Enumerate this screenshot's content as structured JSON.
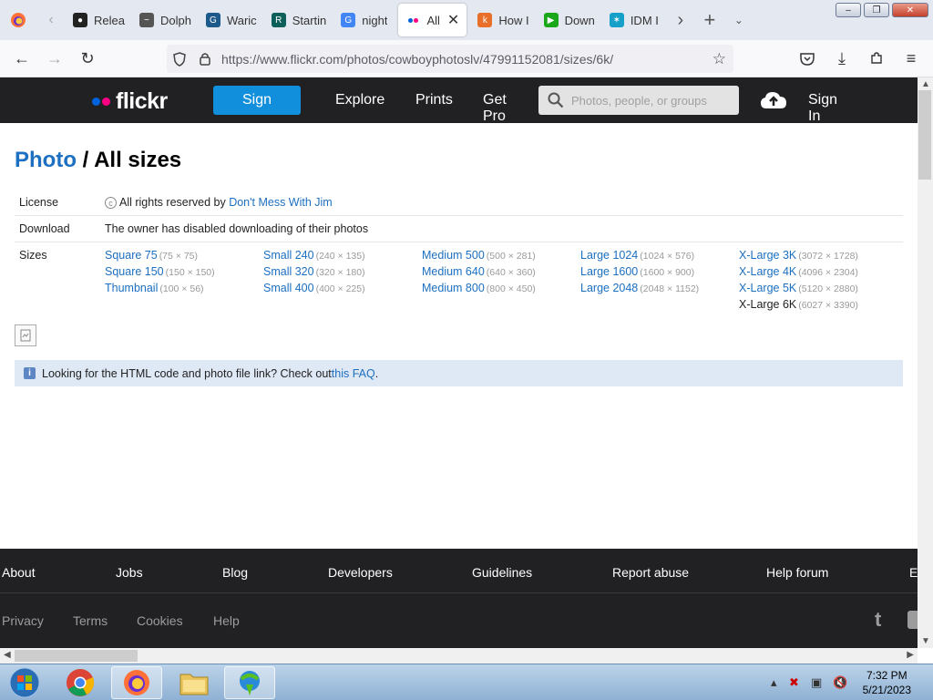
{
  "browser": {
    "tabs": [
      {
        "label": "Relea",
        "icon": "github-icon"
      },
      {
        "label": "Dolph",
        "icon": "dolphin-icon"
      },
      {
        "label": "Waric",
        "icon": "g-logo-icon"
      },
      {
        "label": "Startin",
        "icon": "r-logo-icon"
      },
      {
        "label": "night",
        "icon": "google-icon"
      },
      {
        "label": "All",
        "icon": "flickr-icon",
        "active": true
      },
      {
        "label": "How I",
        "icon": "orange-logo-icon"
      },
      {
        "label": "Down",
        "icon": "play-icon"
      },
      {
        "label": "IDM I",
        "icon": "idm-icon"
      }
    ],
    "url": "https://www.flickr.com/photos/cowboyphotoslv/47991152081/sizes/6k/"
  },
  "header": {
    "logo": "flickr",
    "sign_label": "Sign",
    "explore": "Explore",
    "prints": "Prints",
    "getpro": "Get Pro",
    "search_placeholder": "Photos, people, or groups",
    "signin": "Sign In",
    "colors": {
      "blue_dot": "#0063dc",
      "pink_dot": "#ff0084",
      "sign_button": "#128fdc"
    }
  },
  "page": {
    "title_link": "Photo",
    "title_rest": " / All sizes",
    "license_label": "License",
    "license_text": "All rights reserved by ",
    "license_owner": "Don't Mess With Jim",
    "download_label": "Download",
    "download_text": "The owner has disabled downloading of their photos",
    "sizes_label": "Sizes",
    "sizes": [
      [
        {
          "name": "Square 75",
          "dim": "(75 × 75)"
        },
        {
          "name": "Square 150",
          "dim": "(150 × 150)"
        },
        {
          "name": "Thumbnail",
          "dim": "(100 × 56)"
        }
      ],
      [
        {
          "name": "Small 240",
          "dim": "(240 × 135)"
        },
        {
          "name": "Small 320",
          "dim": "(320 × 180)"
        },
        {
          "name": "Small 400",
          "dim": "(400 × 225)"
        }
      ],
      [
        {
          "name": "Medium 500",
          "dim": "(500 × 281)"
        },
        {
          "name": "Medium 640",
          "dim": "(640 × 360)"
        },
        {
          "name": "Medium 800",
          "dim": "(800 × 450)"
        }
      ],
      [
        {
          "name": "Large 1024",
          "dim": "(1024 × 576)"
        },
        {
          "name": "Large 1600",
          "dim": "(1600 × 900)"
        },
        {
          "name": "Large 2048",
          "dim": "(2048 × 1152)"
        }
      ],
      [
        {
          "name": "X-Large 3K",
          "dim": "(3072 × 1728)"
        },
        {
          "name": "X-Large 4K",
          "dim": "(4096 × 2304)"
        },
        {
          "name": "X-Large 5K",
          "dim": "(5120 × 2880)"
        },
        {
          "name": "X-Large 6K",
          "dim": "(6027 × 3390)",
          "current": true
        }
      ]
    ],
    "faq_text": "Looking for the HTML code and photo file link? Check out ",
    "faq_link": "this FAQ",
    "faq_end": "."
  },
  "footer": {
    "row1": [
      "About",
      "Jobs",
      "Blog",
      "Developers",
      "Guidelines",
      "Report abuse",
      "Help forum",
      "E"
    ],
    "row2": [
      "Privacy",
      "Terms",
      "Cookies",
      "Help"
    ]
  },
  "taskbar": {
    "time": "7:32 PM",
    "date": "5/21/2023"
  }
}
